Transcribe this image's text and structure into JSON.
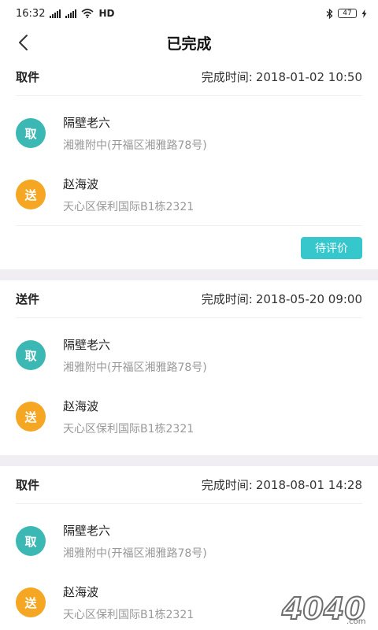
{
  "status_bar": {
    "time": "16:32",
    "network": "HD",
    "battery": "47"
  },
  "nav": {
    "title": "已完成"
  },
  "orders": [
    {
      "type": "取件",
      "time_label": "完成时间:",
      "time_value": "2018-01-02 10:50",
      "pickup": {
        "badge": "取",
        "name": "隔壁老六",
        "address": "湘雅附中(开福区湘雅路78号)"
      },
      "delivery": {
        "badge": "送",
        "name": "赵海波",
        "address": "天心区保利国际B1栋2321"
      },
      "action": "待评价"
    },
    {
      "type": "送件",
      "time_label": "完成时间:",
      "time_value": "2018-05-20 09:00",
      "pickup": {
        "badge": "取",
        "name": "隔壁老六",
        "address": "湘雅附中(开福区湘雅路78号)"
      },
      "delivery": {
        "badge": "送",
        "name": "赵海波",
        "address": "天心区保利国际B1栋2321"
      }
    },
    {
      "type": "取件",
      "time_label": "完成时间:",
      "time_value": "2018-08-01 14:28",
      "pickup": {
        "badge": "取",
        "name": "隔壁老六",
        "address": "湘雅附中(开福区湘雅路78号)"
      },
      "delivery": {
        "badge": "送",
        "name": "赵海波",
        "address": "天心区保利国际B1栋2321"
      }
    }
  ],
  "colors": {
    "pickup_badge": "#3cb8b4",
    "delivery_badge": "#f5a623",
    "action_button": "#36c7cc",
    "divider_band": "#f1eef3"
  },
  "watermark": {
    "text": "4040",
    "suffix": ".com"
  }
}
